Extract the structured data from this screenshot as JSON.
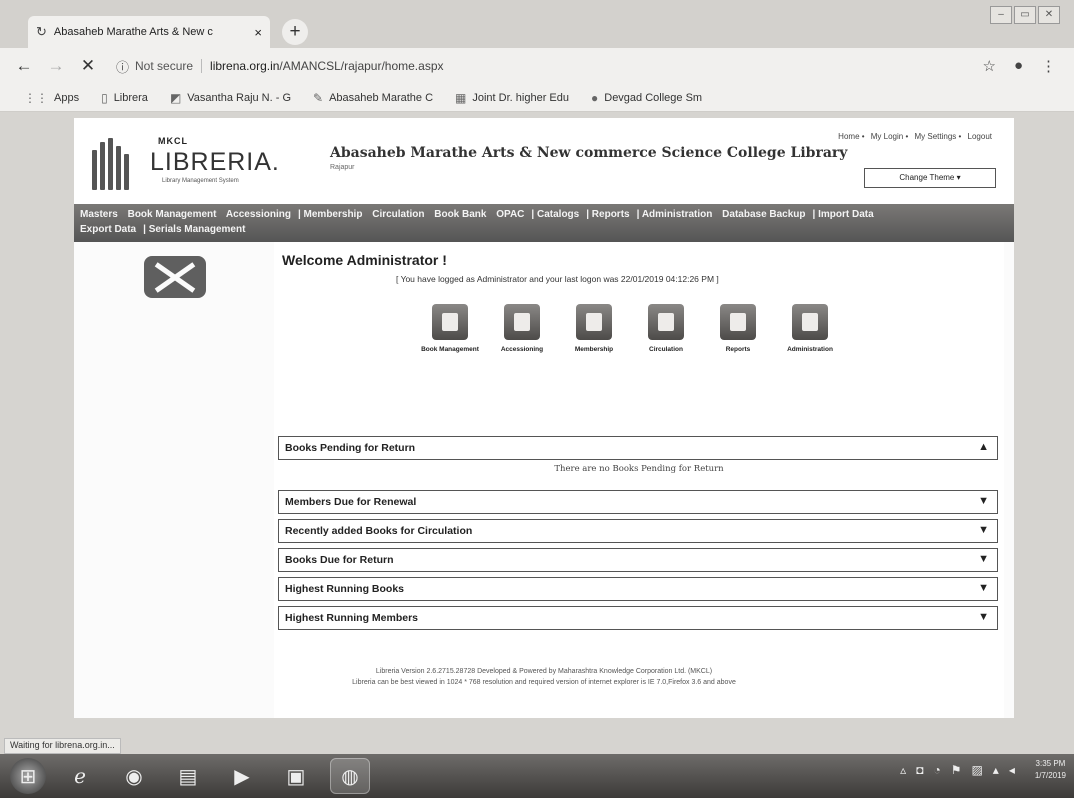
{
  "browser": {
    "tab_title": "Abasaheb Marathe Arts & New c",
    "tab_close": "×",
    "new_tab": "+",
    "window_controls": [
      "–",
      "▭",
      "✕"
    ],
    "not_secure": "Not secure",
    "url_host": "librena.org.in",
    "url_path": "/AMANCSL/rajapur/home.aspx",
    "bookmarks": [
      {
        "label": "Apps",
        "icon": "apps-icon"
      },
      {
        "label": "Librera",
        "icon": "page-icon"
      },
      {
        "label": "Vasantha Raju N. - G",
        "icon": "scholar-icon"
      },
      {
        "label": "Abasaheb Marathe C",
        "icon": "site-icon"
      },
      {
        "label": "Joint Dr. higher Edu",
        "icon": "site-icon"
      },
      {
        "label": "Devgad College Sm",
        "icon": "site-icon"
      }
    ],
    "status": "Waiting for librena.org.in..."
  },
  "site": {
    "logo_small": "MKCL",
    "logo_brand": "LIBRERIA.",
    "logo_tagline": "Library Management System",
    "college_name": "Abasaheb Marathe Arts & New commerce Science College Library",
    "college_sub": "Rajapur",
    "top_links": [
      "Home",
      "My Login",
      "My Settings",
      "Logout"
    ],
    "theme_button": "Change Theme ▾",
    "menu": [
      "Masters",
      "Book Management",
      "Accessioning",
      "Membership",
      "Circulation",
      "Book Bank",
      "OPAC",
      "Catalogs",
      "Reports",
      "Administration",
      "Database Backup",
      "Import Data",
      "Export Data",
      "Serials Management"
    ],
    "welcome": "Welcome Administrator !",
    "logon_info": "[ You have logged as Administrator and your last logon was 22/01/2019 04:12:26 PM ]",
    "modules": [
      "Book Management",
      "Accessioning",
      "Membership",
      "Circulation",
      "Reports",
      "Administration"
    ],
    "panels": [
      {
        "title": "Books Pending for Return",
        "toggle": "▲"
      },
      {
        "title": "Members Due for Renewal",
        "toggle": "▼"
      },
      {
        "title": "Recently added Books for Circulation",
        "toggle": "▼"
      },
      {
        "title": "Books Due for Return",
        "toggle": "▼"
      },
      {
        "title": "Highest Running Books",
        "toggle": "▼"
      },
      {
        "title": "Highest Running Members",
        "toggle": "▼"
      }
    ],
    "pending_message": "There are no Books Pending for Return",
    "footer_line1": "Libreria Version 2.6.2715.28728 Developed & Powered by Maharashtra Knowledge Corporation Ltd. (MKCL)",
    "footer_line2": "Libreria can be best viewed in 1024 * 768 resolution and required version of internet explorer is IE 7.0,Firefox 3.6 and above"
  },
  "taskbar": {
    "clock_time": "3:35 PM",
    "clock_date": "1/7/2019"
  }
}
